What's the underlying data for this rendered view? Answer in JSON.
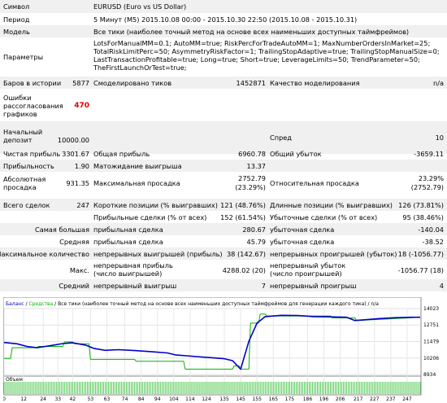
{
  "report": {
    "symbol_label": "Символ",
    "symbol_value": "EURUSD (Euro vs US Dollar)",
    "period_label": "Период",
    "period_value": "5 Минут (M5) 2015.10.08 00:00 - 2015.10.30 22:50 (2015.10.08 - 2015.10.31)",
    "model_label": "Модель",
    "model_value": "Все тики (наиболее точный метод на основе всех наименьших доступных таймфреймов)",
    "params_label": "Параметры",
    "params_lines": [
      "LotsForManualMM=0.1; AutoMM=true; RiskPercForTradeAutoMM=1; MaxNumberOrdersInMarket=25;",
      "TotalRiskLimitPerc=50; AsymmetryRiskFactor=1; TrailingStopAdaptive=true; TrailingStopManualSize=0;",
      "LastTransactionProfitable=true; Long=true; Short=true; LeverageLimits=50; TrendParameter=50;",
      "TheFirstLaunchOrTest=true;"
    ],
    "bars_label": "Баров в истории",
    "bars_value": "5877",
    "ticks_label": "Смоделировано тиков",
    "ticks_value": "1452871",
    "quality_label": "Качество моделирования",
    "quality_value": "n/a",
    "errors_label": "Ошибки рассогласования графиков",
    "errors_value": "470",
    "deposit_label": "Начальный депозит",
    "deposit_value": "10000.00",
    "spread_label": "Спред",
    "spread_value": "10",
    "net_profit_label": "Чистая прибыль",
    "net_profit_value": "3301.67",
    "gross_profit_label": "Общая прибыль",
    "gross_profit_value": "6960.78",
    "gross_loss_label": "Общий убыток",
    "gross_loss_value": "-3659.11",
    "profit_factor_label": "Прибыльность",
    "profit_factor_value": "1.90",
    "expected_payoff_label": "Матожидание выигрыша",
    "expected_payoff_value": "13.37",
    "abs_dd_label": "Абсолютная просадка",
    "abs_dd_value": "931.35",
    "max_dd_label": "Максимальная просадка",
    "max_dd_value_1": "2752.79",
    "max_dd_value_2": "(23.29%)",
    "rel_dd_label": "Относительная просадка",
    "rel_dd_value_1": "23.29%",
    "rel_dd_value_2": "(2752.79)",
    "total_trades_label": "Всего сделок",
    "total_trades_value": "247",
    "short_pos_label": "Короткие позиции (% выигравших)",
    "short_pos_value": "121 (48.76%)",
    "long_pos_label": "Длинные позиции (% выигравших)",
    "long_pos_value": "126 (73.81%)",
    "profit_trades_label": "Прибыльные сделки (% от всех)",
    "profit_trades_value": "152 (61.54%)",
    "loss_trades_label": "Убыточные сделки (% от всех)",
    "loss_trades_value": "95 (38.46%)",
    "largest_label": "Самая большая",
    "largest_profit_label": "прибыльная сделка",
    "largest_profit_value": "280.67",
    "largest_loss_label": "убыточная сделка",
    "largest_loss_value": "-140.04",
    "average_label": "Средняя",
    "average_profit_label": "прибыльная сделка",
    "average_profit_value": "45.79",
    "average_loss_label": "убыточная сделка",
    "average_loss_value": "-38.52",
    "max_count_label": "Максимальное количество",
    "max_cons_wins_label": "непрерывных выигрышей (прибыль)",
    "max_cons_wins_value": "38 (142.67)",
    "max_cons_losses_label": "непрерывных проигрышей (убыток)",
    "max_cons_losses_value": "18 (-1056.77)",
    "max_label": "Макс.",
    "max_cons_profit_label": "непрерывная прибыль (число выигрышей)",
    "max_cons_profit_value": "4288.02 (20)",
    "max_cons_loss_label": "непрерывный убыток (число проигрышей)",
    "max_cons_loss_value": "-1056.77 (18)",
    "avg_label": "Средний",
    "avg_cons_wins_label": "непрерывный выигрыш",
    "avg_cons_wins_value": "7",
    "avg_cons_losses_label": "непрерывный проигрыш",
    "avg_cons_losses_value": "4"
  },
  "chart_data": {
    "type": "line",
    "legend_balance": "Баланс",
    "legend_equity": "Средства",
    "legend_note": "Все тики (наиболее точный метод на основе всех наименьших доступных таймфреймов для генерации каждого тика) / n/a",
    "volume_label": "Объем",
    "ylim": [
      8934,
      14023
    ],
    "y_ticks": [
      14023,
      12751,
      11479,
      10206,
      8934
    ],
    "xlim": [
      0,
      255
    ],
    "x_ticks": [
      0,
      12,
      24,
      33,
      42,
      53,
      63,
      74,
      84,
      94,
      104,
      114,
      124,
      135,
      145,
      155,
      165,
      175,
      186,
      196,
      206,
      217,
      227,
      237,
      247
    ],
    "balance_color": "#0000c8",
    "equity_color": "#00b400",
    "series": [
      {
        "name": "Баланс",
        "x": [
          0,
          8,
          14,
          20,
          28,
          36,
          42,
          50,
          55,
          62,
          70,
          80,
          90,
          100,
          105,
          115,
          125,
          135,
          140,
          145,
          150,
          155,
          160,
          170,
          180,
          190,
          200,
          210,
          215,
          220,
          230,
          240,
          250,
          255
        ],
        "y": [
          11400,
          11300,
          11100,
          11000,
          11150,
          11320,
          11380,
          11200,
          10950,
          10800,
          10850,
          10780,
          10700,
          10600,
          10450,
          10350,
          10250,
          10150,
          10000,
          9350,
          11500,
          12900,
          13400,
          13500,
          13480,
          13400,
          13380,
          13350,
          13100,
          13150,
          13250,
          13320,
          13350,
          13350
        ]
      },
      {
        "name": "Средства",
        "x": [
          0,
          4,
          5,
          20,
          21,
          36,
          37,
          42,
          43,
          52,
          53,
          80,
          81,
          110,
          111,
          140,
          141,
          144,
          145,
          150,
          151,
          156,
          157,
          160,
          161,
          200,
          201,
          215,
          216,
          255
        ],
        "y": [
          10180,
          10180,
          11000,
          11000,
          11100,
          11100,
          11450,
          11450,
          11300,
          11300,
          10100,
          10100,
          9950,
          9950,
          9350,
          9350,
          9600,
          9600,
          9350,
          9350,
          12900,
          12900,
          13600,
          13600,
          13450,
          13450,
          13300,
          13300,
          13100,
          13350
        ]
      }
    ]
  }
}
